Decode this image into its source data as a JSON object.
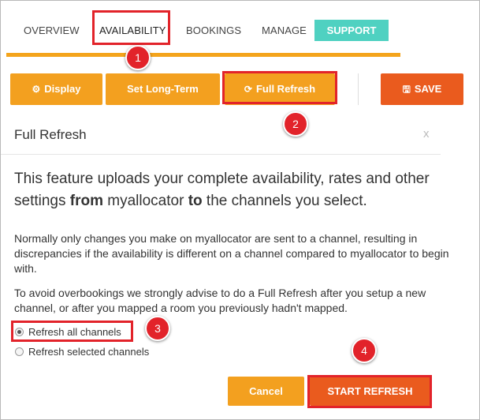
{
  "nav": {
    "items": [
      "OVERVIEW",
      "AVAILABILITY",
      "BOOKINGS",
      "MANAGE"
    ],
    "support": "SUPPORT"
  },
  "toolbar": {
    "display": "Display",
    "long_term": "Set Long-Term",
    "full_refresh": "Full Refresh",
    "save": "SAVE"
  },
  "dialog": {
    "title": "Full Refresh",
    "close": "x",
    "lead_1": "This feature uploads your complete availability, rates and other settings ",
    "lead_from": "from",
    "lead_2": " myallocator ",
    "lead_to": "to",
    "lead_3": " the channels you select.",
    "para1": "Normally only changes you make on myallocator are sent to a channel, resulting in discrepancies if the availability is different on a channel compared to myallocator to begin with.",
    "para2": "To avoid overbookings we strongly advise to do a Full Refresh after you setup a new channel, or after you mapped a room you previously hadn't mapped.",
    "options": [
      {
        "label": "Refresh all channels",
        "checked": true
      },
      {
        "label": "Refresh selected channels",
        "checked": false
      }
    ],
    "cancel": "Cancel",
    "start": "START REFRESH"
  },
  "annotations": [
    "1",
    "2",
    "3",
    "4"
  ],
  "colors": {
    "orange": "#f3a01f",
    "save_red_orange": "#ea5b1e",
    "support_teal": "#4fd1c1",
    "annotation_red": "#e2232a"
  }
}
